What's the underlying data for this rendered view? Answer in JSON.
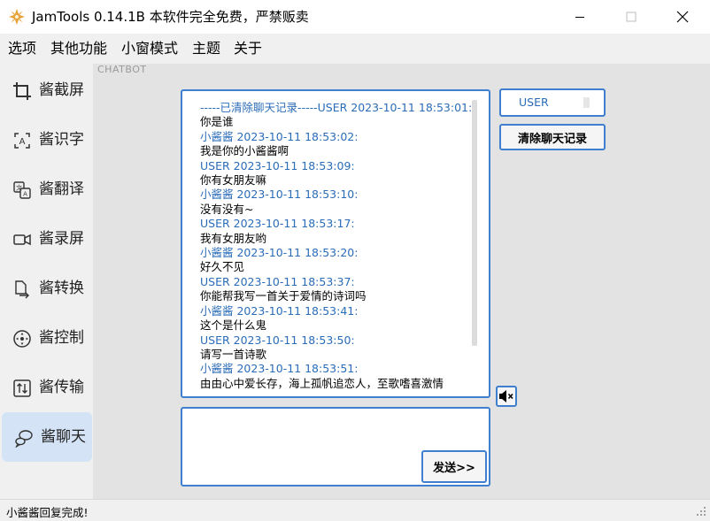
{
  "window": {
    "title": "JamTools 0.14.1B 本软件完全免费，严禁贩卖"
  },
  "menu": [
    "选项",
    "其他功能",
    "小窗模式",
    "主题",
    "关于"
  ],
  "sidebar": {
    "items": [
      {
        "label": "酱截屏",
        "icon": "crop-icon"
      },
      {
        "label": "酱识字",
        "icon": "text-recognition-icon"
      },
      {
        "label": "酱翻译",
        "icon": "translate-icon"
      },
      {
        "label": "酱录屏",
        "icon": "video-camera-icon"
      },
      {
        "label": "酱转换",
        "icon": "file-convert-icon"
      },
      {
        "label": "酱控制",
        "icon": "remote-control-icon"
      },
      {
        "label": "酱传输",
        "icon": "transfer-icon"
      },
      {
        "label": "酱聊天",
        "icon": "chat-icon"
      }
    ],
    "active": "酱聊天"
  },
  "main": {
    "section_label": "CHATBOT",
    "chat_log": [
      {
        "kind": "clear",
        "text": "-----已清除聊天记录-----USER 2023-10-11 18:53:01:"
      },
      {
        "kind": "msg",
        "text": "你是谁"
      },
      {
        "kind": "bot",
        "text": "小酱酱 2023-10-11 18:53:02:"
      },
      {
        "kind": "msg",
        "text": "我是你的小酱酱啊"
      },
      {
        "kind": "user",
        "text": "USER 2023-10-11 18:53:09:"
      },
      {
        "kind": "msg",
        "text": "你有女朋友嘛"
      },
      {
        "kind": "bot",
        "text": "小酱酱 2023-10-11 18:53:10:"
      },
      {
        "kind": "msg",
        "text": "没有没有~"
      },
      {
        "kind": "user",
        "text": "USER 2023-10-11 18:53:17:"
      },
      {
        "kind": "msg",
        "text": "我有女朋友哟"
      },
      {
        "kind": "bot",
        "text": "小酱酱 2023-10-11 18:53:20:"
      },
      {
        "kind": "msg",
        "text": "好久不见"
      },
      {
        "kind": "user",
        "text": "USER 2023-10-11 18:53:37:"
      },
      {
        "kind": "msg",
        "text": "你能帮我写一首关于爱情的诗词吗"
      },
      {
        "kind": "bot",
        "text": "小酱酱 2023-10-11 18:53:41:"
      },
      {
        "kind": "msg",
        "text": "这个是什么鬼"
      },
      {
        "kind": "user",
        "text": "USER 2023-10-11 18:53:50:"
      },
      {
        "kind": "msg",
        "text": "请写一首诗歌"
      },
      {
        "kind": "bot",
        "text": "小酱酱 2023-10-11 18:53:51:"
      },
      {
        "kind": "msg",
        "text": "由由心中爱长存，海上孤帆追恋人，至歌嗜喜激情"
      }
    ],
    "input_value": "",
    "send_label": "发送>>",
    "role_value": "USER",
    "clear_label": "清除聊天记录",
    "mute_icon": "speaker-mute-icon"
  },
  "status": {
    "text": "小酱酱回复完成!"
  },
  "colors": {
    "accent": "#3f7fd0",
    "timestamp": "#2b6cb8",
    "active_nav": "#d4e4f6"
  }
}
